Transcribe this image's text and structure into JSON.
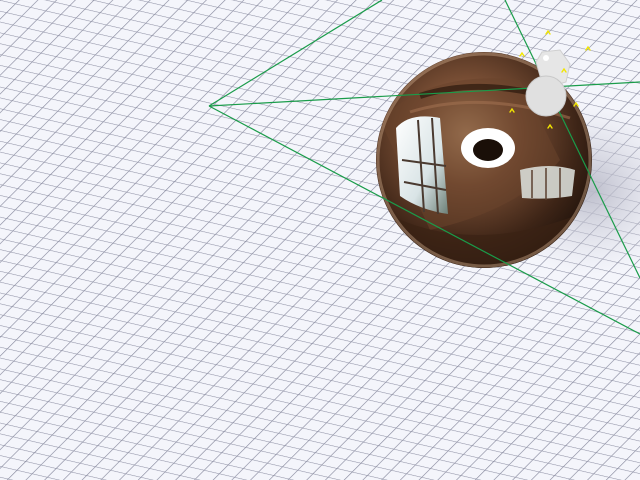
{
  "viewport": {
    "background": "#e9eaf2",
    "grid_line_color": "#8d8fa3",
    "grid_cell_color": "#f4f5fb",
    "frustum_line_color": "#1a9c4a",
    "sphere_material": "chrome-reflective",
    "sphere_base_color": "#5a3a28",
    "light_gizmo_color": "#dcdcdc",
    "light_marker_color": "#f2e600",
    "sphere_shadow_color": "#c9cad6"
  }
}
